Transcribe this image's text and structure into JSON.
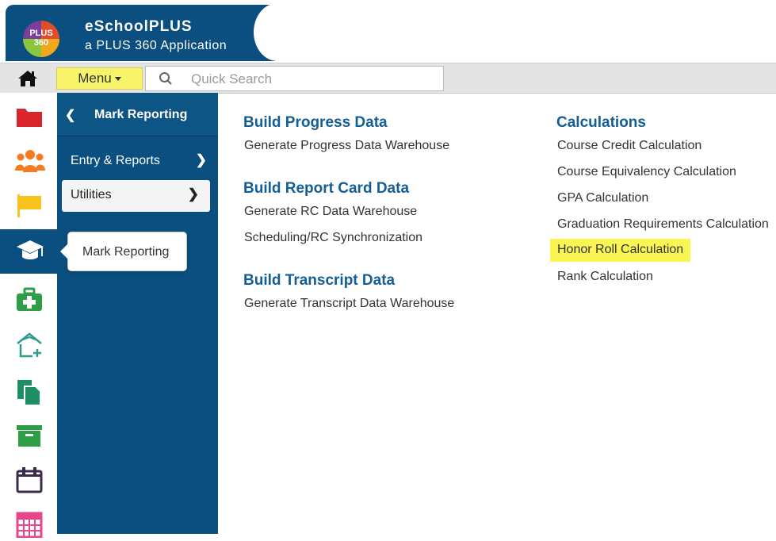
{
  "header": {
    "logo_line1": "PLUS",
    "logo_line2": "360",
    "app_title": "eSchoolPLUS",
    "app_subtitle": "a PLUS 360 Application"
  },
  "toolbar": {
    "home_icon": "home-icon",
    "menu_label": "Menu",
    "search_placeholder": "Quick Search",
    "highlight_color": "#f7f36b"
  },
  "rail": {
    "items": [
      {
        "icon": "folder-icon",
        "color": "#d9262c"
      },
      {
        "icon": "people-icon",
        "color": "#f47b20"
      },
      {
        "icon": "flag-icon",
        "color": "#f8c21f"
      },
      {
        "icon": "graduation-cap-icon",
        "color": "#ffffff",
        "active": true
      },
      {
        "icon": "medical-kit-icon",
        "color": "#2e9d48"
      },
      {
        "icon": "home-add-icon",
        "color": "#2a9d8f"
      },
      {
        "icon": "documents-icon",
        "color": "#1e8f64"
      },
      {
        "icon": "archive-box-icon",
        "color": "#2e9d48"
      },
      {
        "icon": "calendar-icon",
        "color": "#5b2c6f"
      },
      {
        "icon": "calculator-icon",
        "color": "#e8468b"
      }
    ]
  },
  "submenu": {
    "title": "Mark Reporting",
    "items": [
      {
        "label": "Entry & Reports"
      },
      {
        "label": "Utilities",
        "selected": true
      }
    ]
  },
  "tooltip": {
    "text": "Mark Reporting"
  },
  "content": {
    "left_sections": [
      {
        "title": "Build Progress Data",
        "links": [
          "Generate Progress Data Warehouse"
        ]
      },
      {
        "title": "Build Report Card Data",
        "links": [
          "Generate RC Data Warehouse",
          "Scheduling/RC Synchronization"
        ]
      },
      {
        "title": "Build Transcript Data",
        "links": [
          "Generate Transcript Data Warehouse"
        ]
      }
    ],
    "right_section": {
      "title": "Calculations",
      "links": [
        "Course Credit Calculation",
        "Course Equivalency Calculation",
        "GPA Calculation",
        "Graduation Requirements Calculation",
        "Honor Roll Calculation",
        "Rank Calculation"
      ],
      "highlighted_link": "Honor Roll Calculation"
    }
  },
  "colors": {
    "brand_blue": "#0a4f7f",
    "section_title": "#135e96",
    "link_highlight": "#f9f552"
  }
}
